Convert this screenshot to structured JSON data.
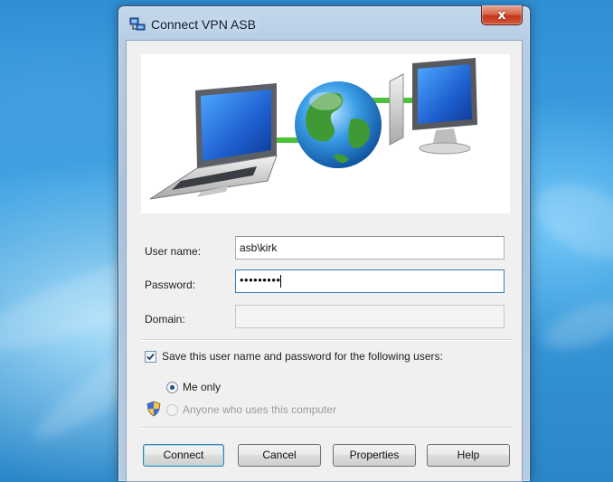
{
  "window": {
    "title": "Connect VPN ASB",
    "close_label": "x"
  },
  "icons": {
    "title": "network-connection-icon",
    "close": "close-icon",
    "banner": "vpn-laptop-globe-computer-illustration",
    "shield": "uac-shield-icon"
  },
  "form": {
    "username_label": "User name:",
    "username_value": "asb\\kirk",
    "password_label": "Password:",
    "password_value": "•••••••••",
    "domain_label": "Domain:",
    "domain_value": ""
  },
  "save": {
    "checkbox_label": "Save this user name and password for the following users:",
    "checked": true,
    "option_me_only": "Me only",
    "option_anyone": "Anyone who uses this computer",
    "selected": "Me only"
  },
  "buttons": {
    "connect": "Connect",
    "cancel": "Cancel",
    "properties": "Properties",
    "help": "Help"
  },
  "colors": {
    "desktop": "#2a86c8",
    "focus_border": "#3c7fb1",
    "close_red": "#c2371d"
  }
}
